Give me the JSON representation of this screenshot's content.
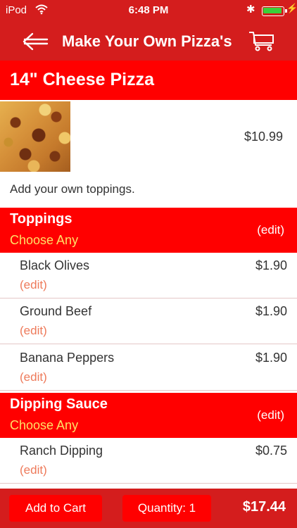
{
  "status": {
    "carrier": "iPod",
    "time": "6:48 PM"
  },
  "nav": {
    "title": "Make Your Own Pizza's"
  },
  "product": {
    "name": "14\" Cheese Pizza",
    "price": "$10.99",
    "description": "Add your own toppings."
  },
  "sections": [
    {
      "title": "Toppings",
      "subtitle": "Choose Any",
      "edit": "(edit)",
      "items": [
        {
          "name": "Black Olives",
          "price": "$1.90",
          "edit": "(edit)"
        },
        {
          "name": "Ground Beef",
          "price": "$1.90",
          "edit": "(edit)"
        },
        {
          "name": "Banana Peppers",
          "price": "$1.90",
          "edit": "(edit)"
        }
      ]
    },
    {
      "title": "Dipping Sauce",
      "subtitle": "Choose Any",
      "edit": "(edit)",
      "items": [
        {
          "name": "Ranch Dipping",
          "price": "$0.75",
          "edit": "(edit)"
        }
      ]
    }
  ],
  "footer": {
    "add_to_cart": "Add to Cart",
    "quantity": "Quantity: 1",
    "total": "$17.44"
  },
  "icons": {
    "back": "back-arrow-icon",
    "cart": "shopping-cart-icon",
    "wifi": "wifi-icon",
    "bluetooth": "bluetooth-icon",
    "battery": "battery-icon",
    "charging": "charging-bolt-icon"
  },
  "colors": {
    "nav_red": "#d41d1d",
    "header_red": "#ff0000",
    "subtitle_yellow": "#ffe066",
    "edit_link": "#ee7a5a"
  }
}
